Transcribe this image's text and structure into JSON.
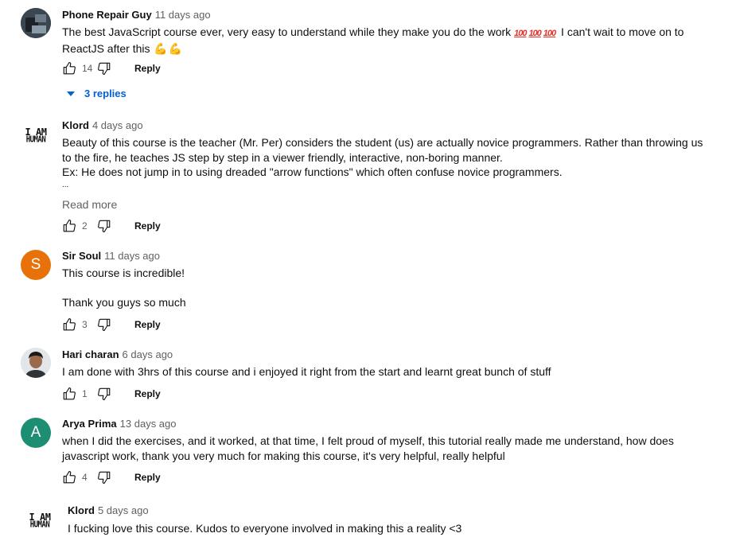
{
  "comments": [
    {
      "author": "Phone Repair Guy",
      "time": "11 days ago",
      "avatar": {
        "type": "photo"
      },
      "text_before_emoji": "The best JavaScript course ever, very easy to understand while they make you do the work",
      "emoji_100": "100",
      "text_after_emoji": "I can't wait to move on to ReactJS after this",
      "emoji_muscle": "💪",
      "likes": "14",
      "reply_label": "Reply",
      "replies_label": "3 replies"
    },
    {
      "author": "Klord",
      "time": "4 days ago",
      "avatar": {
        "type": "text",
        "line1": "I AM",
        "line2": "HUMAN"
      },
      "lines": [
        "Beauty of this course is the teacher (Mr. Per) considers the student (us) are actually novice programmers. Rather than throwing us to the fire, he teaches JS step by step in a viewer friendly, interactive, non-boring manner.",
        "Ex: He does not jump in to using dreaded \"arrow functions\" which often confuse novice programmers."
      ],
      "ellipsis": "...",
      "read_more": "Read more",
      "likes": "2",
      "reply_label": "Reply"
    },
    {
      "author": "Sir Soul",
      "time": "11 days ago",
      "avatar": {
        "type": "letter",
        "letter": "S",
        "color": "#e8710a"
      },
      "lines": [
        "This course is incredible!",
        "Thank you guys so much"
      ],
      "likes": "3",
      "reply_label": "Reply"
    },
    {
      "author": "Hari charan",
      "time": "6 days ago",
      "avatar": {
        "type": "photo"
      },
      "lines": [
        "I am done with 3hrs of this course and i enjoyed it right from the start and learnt great bunch of stuff"
      ],
      "likes": "1",
      "reply_label": "Reply"
    },
    {
      "author": "Arya Prima",
      "time": "13 days ago",
      "avatar": {
        "type": "letter",
        "letter": "A",
        "color": "#1e8e73"
      },
      "lines": [
        "when I did the exercises, and it worked, at that time, I felt proud of myself, this tutorial really made me understand, how does javascript work, thank you very much for making this course, it's very helpful, really helpful"
      ],
      "likes": "4",
      "reply_label": "Reply"
    },
    {
      "author": "Klord",
      "time": "5 days ago",
      "avatar": {
        "type": "text",
        "line1": "I AM",
        "line2": "HUMAN"
      },
      "lines": [
        "I fucking love this course. Kudos to everyone involved in making this a reality <3"
      ]
    }
  ]
}
